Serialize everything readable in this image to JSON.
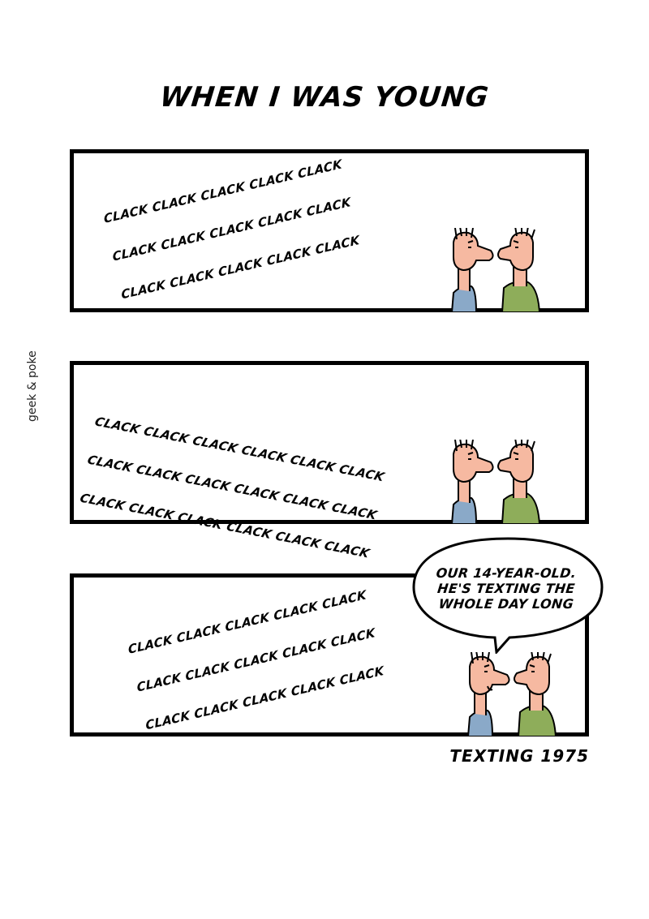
{
  "title": "WHEN I WAS YOUNG",
  "signature": "geek & poke",
  "panels": [
    {
      "clack_lines": [
        "CLACK CLACK CLACK CLACK CLACK",
        "CLACK CLACK CLACK CLACK CLACK",
        "CLACK CLACK CLACK CLACK CLACK"
      ]
    },
    {
      "clack_lines": [
        "CLACK CLACK CLACK CLACK CLACK CLACK",
        "CLACK CLACK CLACK CLACK CLACK CLACK",
        "CLACK CLACK CLACK CLACK CLACK CLACK"
      ]
    },
    {
      "clack_lines": [
        "CLACK CLACK CLACK CLACK CLACK",
        "CLACK CLACK CLACK CLACK CLACK",
        "CLACK CLACK CLACK CLACK CLACK"
      ],
      "speech_lines": [
        "OUR 14-YEAR-OLD.",
        "HE'S TEXTING THE",
        "WHOLE DAY LONG"
      ]
    }
  ],
  "caption": "TEXTING 1975",
  "colors": {
    "skin": "#f6b9a1",
    "shirt_left": "#8aa9c8",
    "shirt_right": "#8ead5a",
    "ink": "#000000"
  }
}
